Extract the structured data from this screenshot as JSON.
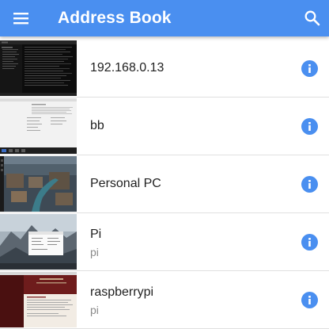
{
  "header": {
    "title": "Address Book",
    "menu_icon": "menu-icon",
    "search_icon": "search-icon"
  },
  "theme": {
    "appbar_color": "#4a8ff0",
    "info_icon_color": "#4a8ff0"
  },
  "hosts": [
    {
      "name": "192.168.0.13",
      "subtitle": ""
    },
    {
      "name": "bb",
      "subtitle": ""
    },
    {
      "name": "Personal PC",
      "subtitle": ""
    },
    {
      "name": "Pi",
      "subtitle": "pi"
    },
    {
      "name": "raspberrypi",
      "subtitle": "pi"
    }
  ]
}
